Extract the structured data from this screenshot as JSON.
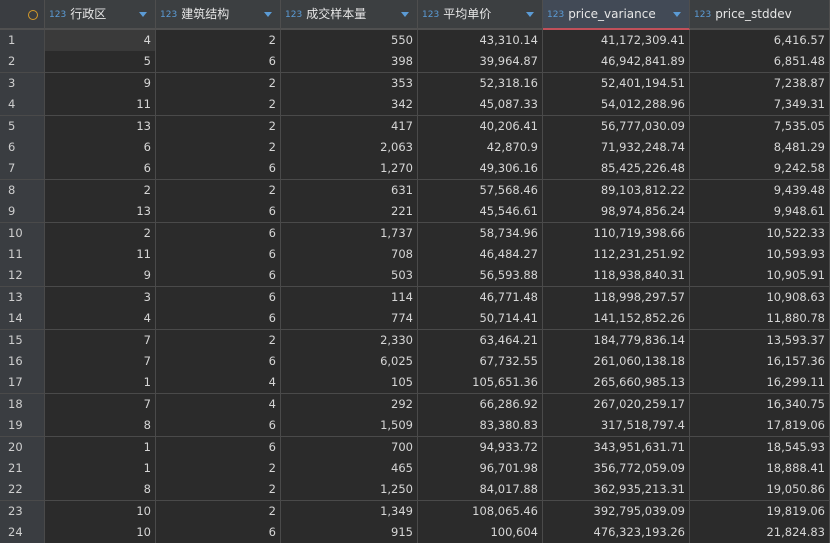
{
  "header": {
    "type_badge": "123",
    "columns": [
      "行政区",
      "建筑结构",
      "成交样本量",
      "平均单价",
      "price_variance",
      "price_stddev"
    ]
  },
  "rows": [
    [
      "1",
      "4",
      "2",
      "550",
      "43,310.14",
      "41,172,309.41",
      "6,416.57"
    ],
    [
      "2",
      "5",
      "6",
      "398",
      "39,964.87",
      "46,942,841.89",
      "6,851.48"
    ],
    [
      "3",
      "9",
      "2",
      "353",
      "52,318.16",
      "52,401,194.51",
      "7,238.87"
    ],
    [
      "4",
      "11",
      "2",
      "342",
      "45,087.33",
      "54,012,288.96",
      "7,349.31"
    ],
    [
      "5",
      "13",
      "2",
      "417",
      "40,206.41",
      "56,777,030.09",
      "7,535.05"
    ],
    [
      "6",
      "6",
      "2",
      "2,063",
      "42,870.9",
      "71,932,248.74",
      "8,481.29"
    ],
    [
      "7",
      "6",
      "6",
      "1,270",
      "49,306.16",
      "85,425,226.48",
      "9,242.58"
    ],
    [
      "8",
      "2",
      "2",
      "631",
      "57,568.46",
      "89,103,812.22",
      "9,439.48"
    ],
    [
      "9",
      "13",
      "6",
      "221",
      "45,546.61",
      "98,974,856.24",
      "9,948.61"
    ],
    [
      "10",
      "2",
      "6",
      "1,737",
      "58,734.96",
      "110,719,398.66",
      "10,522.33"
    ],
    [
      "11",
      "11",
      "6",
      "708",
      "46,484.27",
      "112,231,251.92",
      "10,593.93"
    ],
    [
      "12",
      "9",
      "6",
      "503",
      "56,593.88",
      "118,938,840.31",
      "10,905.91"
    ],
    [
      "13",
      "3",
      "6",
      "114",
      "46,771.48",
      "118,998,297.57",
      "10,908.63"
    ],
    [
      "14",
      "4",
      "6",
      "774",
      "50,714.41",
      "141,152,852.26",
      "11,880.78"
    ],
    [
      "15",
      "7",
      "2",
      "2,330",
      "63,464.21",
      "184,779,836.14",
      "13,593.37"
    ],
    [
      "16",
      "7",
      "6",
      "6,025",
      "67,732.55",
      "261,060,138.18",
      "16,157.36"
    ],
    [
      "17",
      "1",
      "4",
      "105",
      "105,651.36",
      "265,660,985.13",
      "16,299.11"
    ],
    [
      "18",
      "7",
      "4",
      "292",
      "66,286.92",
      "267,020,259.17",
      "16,340.75"
    ],
    [
      "19",
      "8",
      "6",
      "1,509",
      "83,380.83",
      "317,518,797.4",
      "17,819.06"
    ],
    [
      "20",
      "1",
      "6",
      "700",
      "94,933.72",
      "343,951,631.71",
      "18,545.93"
    ],
    [
      "21",
      "1",
      "2",
      "465",
      "96,701.98",
      "356,772,059.09",
      "18,888.41"
    ],
    [
      "22",
      "8",
      "2",
      "1,250",
      "84,017.88",
      "362,935,213.31",
      "19,050.86"
    ],
    [
      "23",
      "10",
      "2",
      "1,349",
      "108,065.46",
      "392,795,039.09",
      "19,819.06"
    ],
    [
      "24",
      "10",
      "6",
      "915",
      "100,604",
      "476,323,193.26",
      "21,824.83"
    ]
  ]
}
